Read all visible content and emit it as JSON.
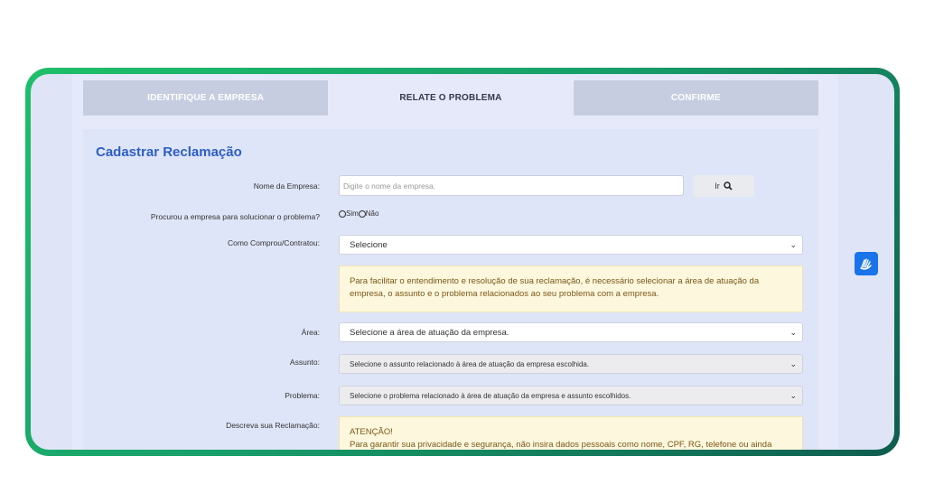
{
  "steps": [
    {
      "label": "IDENTIFIQUE A EMPRESA"
    },
    {
      "label": "RELATE O PROBLEMA"
    },
    {
      "label": "CONFIRME"
    }
  ],
  "form": {
    "title": "Cadastrar Reclamação",
    "company_label": "Nome da Empresa:",
    "company_placeholder": "Digite o nome da empresa.",
    "go_label": "Ir",
    "contacted_label": "Procurou a empresa para solucionar o problema?",
    "yes_label": "Sim",
    "no_label": "Não",
    "purchase_label": "Como Comprou/Contratou:",
    "purchase_value": "Selecione",
    "info_note": "Para facilitar o entendimento e resolução de sua reclamação, é necessário selecionar a área de atuação da empresa, o assunto e o problema relacionados ao seu problema com a empresa.",
    "area_label": "Área:",
    "area_value": "Selecione a área de atuação da empresa.",
    "subject_label": "Assunto:",
    "subject_value": "Selecione o assunto relacionado à área de atuação da empresa escolhida.",
    "problem_label": "Problema:",
    "problem_value": "Selecione o problema relacionado à área de atuação da empresa e assunto escolhidos.",
    "describe_label": "Descreva sua Reclamação:",
    "warning_title": "ATENÇÃO!",
    "warning_text": "Para garantir sua privacidade e segurança, não insira dados pessoais como nome, CPF, RG, telefone ou ainda"
  },
  "icons": {
    "search": "search-icon",
    "accessibility": "sign-language-icon",
    "dropdown": "chevron-down-icon"
  },
  "colors": {
    "title": "#2c5ec5",
    "frame_start": "#1fbf6a",
    "frame_end": "#0f5d4f",
    "note_bg": "#fdf7dd",
    "a11y_button": "#1a73e8"
  }
}
